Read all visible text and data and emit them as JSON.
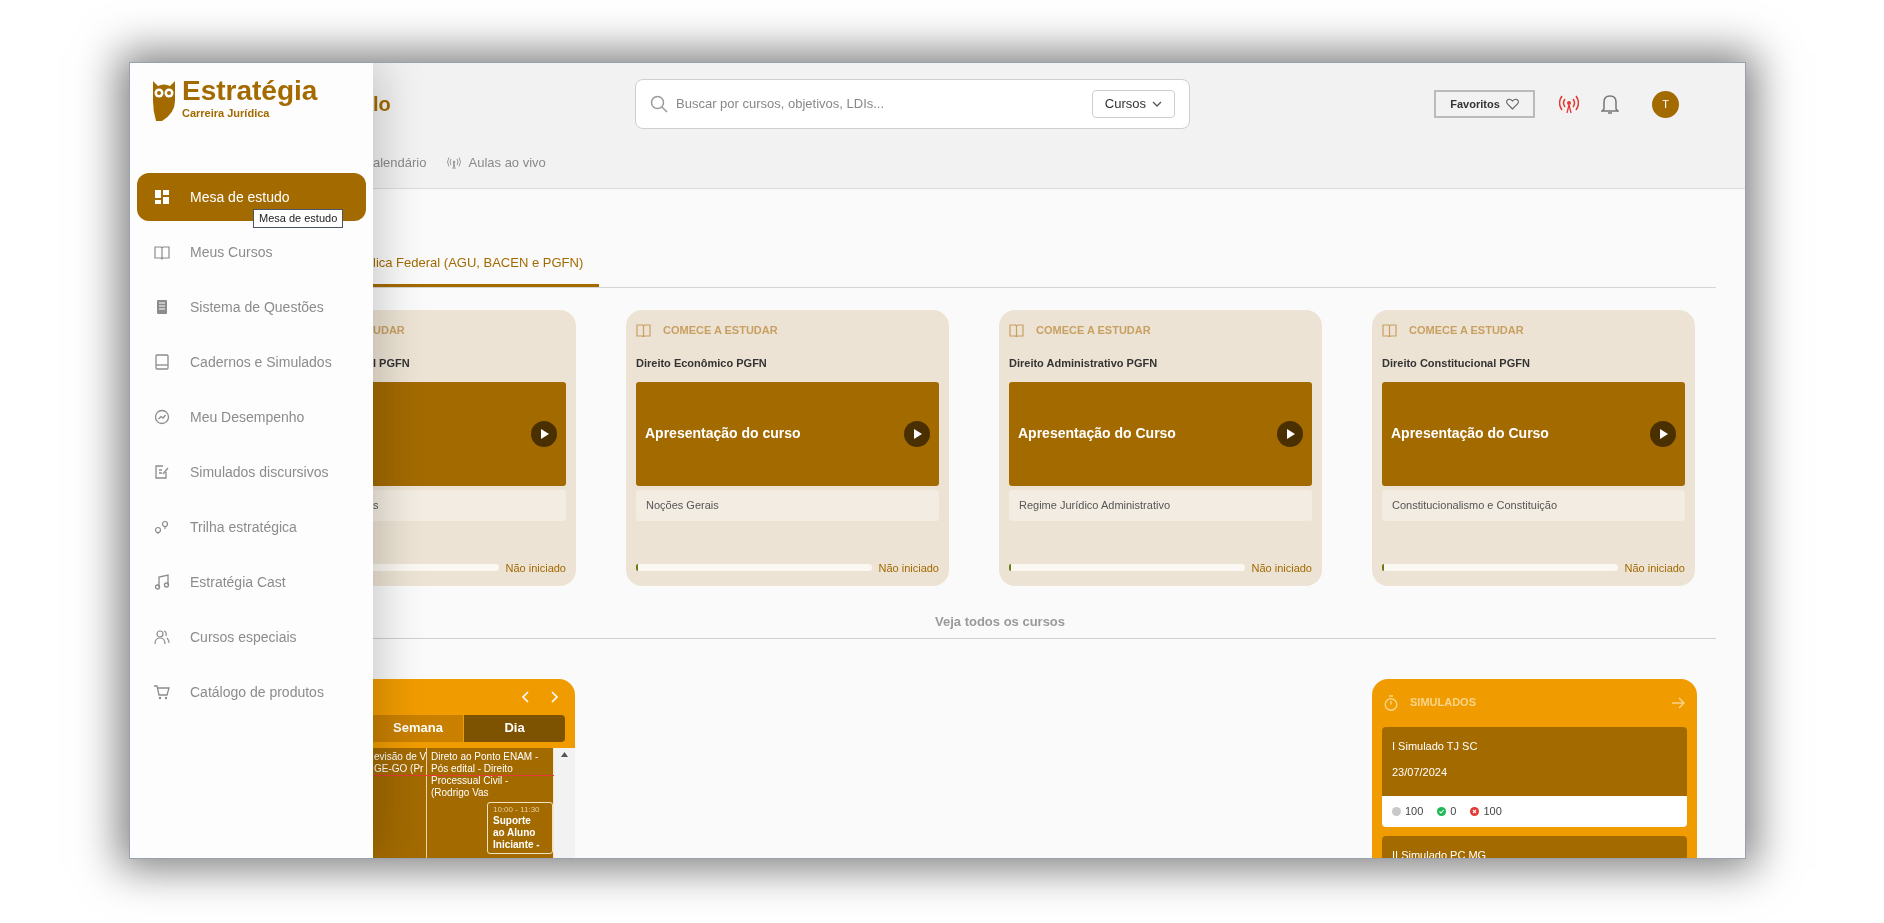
{
  "sidebar": {
    "logo": {
      "name": "Estratégia",
      "subtitle": "Carreira Jurídica"
    },
    "items": [
      {
        "label": "Mesa de estudo",
        "selected": true
      },
      {
        "label": "Meus Cursos",
        "selected": false
      },
      {
        "label": "Sistema de Questões",
        "selected": false
      },
      {
        "label": "Cadernos e Simulados",
        "selected": false
      },
      {
        "label": "Meu Desempenho",
        "selected": false
      },
      {
        "label": "Simulados discursivos",
        "selected": false
      },
      {
        "label": "Trilha estratégica",
        "selected": false
      },
      {
        "label": "Estratégia Cast",
        "selected": false
      },
      {
        "label": "Cursos especiais",
        "selected": false
      },
      {
        "label": "Catálogo de produtos",
        "selected": false
      }
    ],
    "tooltip": "Mesa de estudo"
  },
  "header": {
    "title": "lo",
    "search": {
      "placeholder": "Buscar por cursos, objetivos, LDIs...",
      "filter": "Cursos"
    },
    "favorites": "Favoritos",
    "avatar": "T",
    "nav": [
      {
        "label": "alendário"
      },
      {
        "label": "Aulas ao vivo"
      }
    ]
  },
  "objective_tabs": [
    {
      "label": "lica Federal (AGU, BACEN e PGFN)",
      "selected": true
    }
  ],
  "courses": [
    {
      "tag": "UDAR",
      "title": "l PGFN",
      "module": "s",
      "status": "Não iniciado"
    },
    {
      "tag": "COMECE A ESTUDAR",
      "title": "Direito Econômico PGFN",
      "video_title": "Apresentação do curso",
      "module": "Noções Gerais",
      "status": "Não iniciado",
      "level": 0.008
    },
    {
      "tag": "COMECE A ESTUDAR",
      "title": "Direito Administrativo PGFN",
      "video_title": "Apresentação do Curso",
      "module": "Regime Jurídico Administrativo",
      "status": "Não iniciado",
      "level": 0.008
    },
    {
      "tag": "COMECE A ESTUDAR",
      "title": "Direito Constitucional PGFN",
      "video_title": "Apresentação do Curso",
      "module": "Constitucionalismo e Constituição",
      "status": "Não iniciado",
      "level": 0.008
    }
  ],
  "see_all": "Veja todos os cursos",
  "calendar": {
    "views": [
      {
        "label": "Semana",
        "selected": false
      },
      {
        "label": "Dia",
        "selected": true
      }
    ],
    "events": [
      {
        "lines": [
          "evisão de V",
          "GE-GO (Pr"
        ]
      },
      {
        "lines": [
          "Direto ao Ponto ENAM -",
          "Pós edital - Direito",
          "Processual Civil -",
          "(Rodrigo Vas"
        ]
      },
      {
        "time": "10:00 - 11:30",
        "lines": [
          "Suporte",
          "ao Aluno",
          "Iniciante -"
        ]
      }
    ]
  },
  "simulados": {
    "title": "SIMULADOS",
    "items": [
      {
        "name": "I Simulado TJ SC",
        "date": "23/07/2024",
        "blank": "100",
        "correct": "0",
        "wrong": "100"
      },
      {
        "name": "II Simulado PC MG"
      }
    ]
  }
}
